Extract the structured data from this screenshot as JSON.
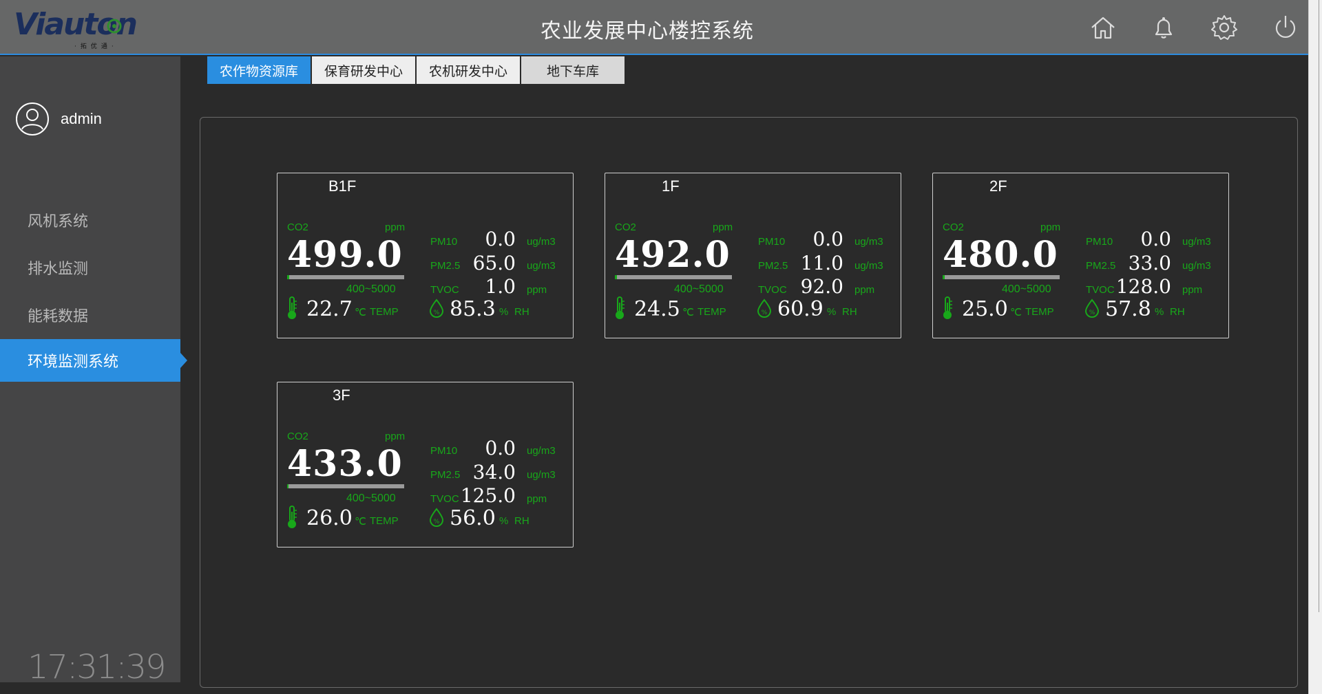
{
  "header": {
    "logo_text": "Viauton",
    "logo_sub": "·拓优通·",
    "title": "农业发展中心楼控系统",
    "icons": [
      "home-icon",
      "bell-icon",
      "gear-icon",
      "power-icon"
    ]
  },
  "user": {
    "name": "admin"
  },
  "sidebar": {
    "items": [
      {
        "label": "风机系统",
        "active": false
      },
      {
        "label": "排水监测",
        "active": false
      },
      {
        "label": "能耗数据",
        "active": false
      },
      {
        "label": "环境监测系统",
        "active": true
      }
    ]
  },
  "clock": "17:31:39",
  "tabs": [
    {
      "label": "农作物资源库",
      "active": true
    },
    {
      "label": "保育研发中心",
      "active": false
    },
    {
      "label": "农机研发中心",
      "active": false
    },
    {
      "label": "地下车库",
      "active": false
    }
  ],
  "labels": {
    "co2": "CO2",
    "ppm": "ppm",
    "range": "400~5000",
    "pm10": "PM10",
    "pm25": "PM2.5",
    "tvoc": "TVOC",
    "ugm3": "ug/m3",
    "temp_unit": "℃",
    "temp": "TEMP",
    "rh_unit": "%",
    "rh": "RH"
  },
  "floors": [
    {
      "name": "B1F",
      "co2": "499.0",
      "co2_level": 0.02,
      "pm10": "0.0",
      "pm25": "65.0",
      "tvoc": "1.0",
      "temp": "22.7",
      "rh": "85.3"
    },
    {
      "name": "1F",
      "co2": "492.0",
      "co2_level": 0.02,
      "pm10": "0.0",
      "pm25": "11.0",
      "tvoc": "92.0",
      "temp": "24.5",
      "rh": "60.9"
    },
    {
      "name": "2F",
      "co2": "480.0",
      "co2_level": 0.02,
      "pm10": "0.0",
      "pm25": "33.0",
      "tvoc": "128.0",
      "temp": "25.0",
      "rh": "57.8"
    },
    {
      "name": "3F",
      "co2": "433.0",
      "co2_level": 0.01,
      "pm10": "0.0",
      "pm25": "34.0",
      "tvoc": "125.0",
      "temp": "26.0",
      "rh": "56.0"
    }
  ],
  "colors": {
    "accent": "#2a8ee0",
    "green": "#18a81a",
    "background": "#2a2a2a",
    "sidebar": "#454546",
    "header": "#666767"
  }
}
